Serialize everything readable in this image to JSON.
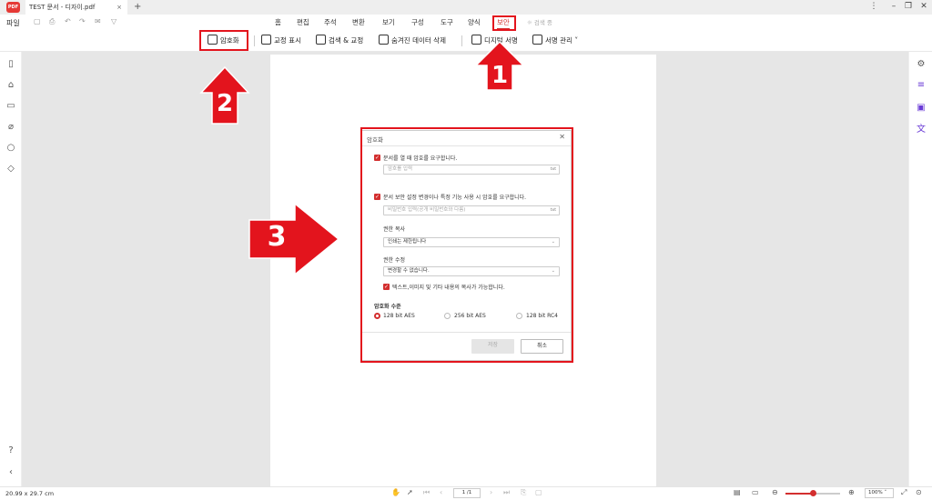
{
  "titlebar": {
    "logo": "PDF",
    "tab_title": "TEST 문서 - 디자이.pdf",
    "close": "×",
    "new_tab": "+",
    "more": "⋮",
    "minimize": "–",
    "restore": "❐",
    "close_window": "✕"
  },
  "menu": {
    "file": "파일",
    "items": [
      "홈",
      "편집",
      "주석",
      "변환",
      "보기",
      "구성",
      "도구",
      "양식",
      "보안"
    ],
    "active": "보안",
    "ai": "검색 중"
  },
  "toolbar": {
    "encrypt": "암호화",
    "redaction_mark": "교정 표시",
    "search_redact": "검색 & 교정",
    "remove_hidden": "숨겨진 데이터 삭제",
    "digital_sign": "디지털 서명",
    "sign_manage": "서명 관리"
  },
  "dialog": {
    "title": "암호화",
    "require_open_pw": "문서를 열 때 암호를 요구합니다.",
    "open_pw_placeholder": "암호를 입력",
    "pw_suffix": "txt",
    "require_perm_pw": "문서 보안 설정 변경이나 특정 기능 사용 시 암호를 요구합니다.",
    "perm_pw_placeholder": "비밀번호 입력(공개 비밀번호와 다름)",
    "print_label": "권한 복사",
    "print_value": "인쇄는 제한됩니다",
    "edit_label": "권한 수정",
    "edit_value": "변경할 수 없습니다.",
    "copy_allowed": "텍스트,이미지 및 기타 내용의 복사가 가능합니다.",
    "level_label": "암호화 수준",
    "levels": [
      "128 bit AES",
      "256 bit AES",
      "128 bit RC4"
    ],
    "selected_level": "128 bit AES",
    "ok": "저장",
    "cancel": "취소"
  },
  "status": {
    "page_size": "20.99 x 29.7 cm",
    "page_indicator": "1 /1",
    "zoom": "100%"
  },
  "annotations": {
    "steps": [
      "1",
      "2",
      "3"
    ],
    "color": "#e3141d"
  }
}
